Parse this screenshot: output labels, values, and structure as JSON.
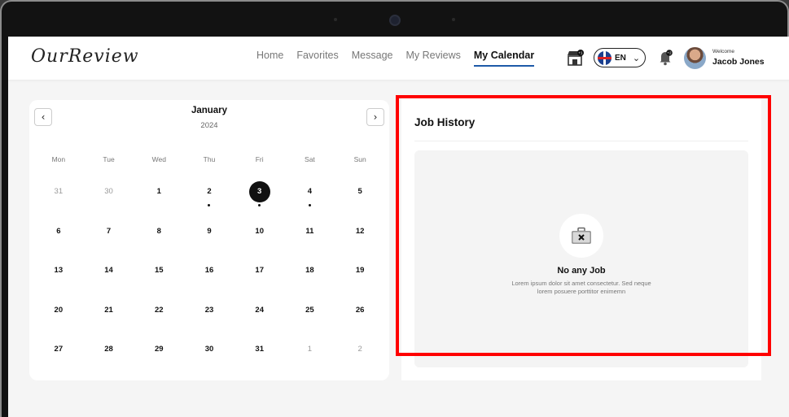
{
  "app": {
    "logo": "OurReview"
  },
  "nav": {
    "items": [
      {
        "label": "Home",
        "active": false
      },
      {
        "label": "Favorites",
        "active": false
      },
      {
        "label": "Message",
        "active": false
      },
      {
        "label": "My Reviews",
        "active": false
      },
      {
        "label": "My Calendar",
        "active": true
      }
    ]
  },
  "header": {
    "store_badge": "+1",
    "language": "EN",
    "notification_badge": "+2",
    "welcome": "Welcome",
    "user_name": "Jacob Jones"
  },
  "calendar": {
    "month": "January",
    "year": "2024",
    "weekdays": [
      "Mon",
      "Tue",
      "Wed",
      "Thu",
      "Fri",
      "Sat",
      "Sun"
    ],
    "days": [
      {
        "n": "31",
        "muted": true
      },
      {
        "n": "30",
        "muted": true
      },
      {
        "n": "1"
      },
      {
        "n": "2",
        "dot": true
      },
      {
        "n": "3",
        "selected": true,
        "dot": true
      },
      {
        "n": "4",
        "dot": true
      },
      {
        "n": "5"
      },
      {
        "n": "6"
      },
      {
        "n": "7"
      },
      {
        "n": "8"
      },
      {
        "n": "9"
      },
      {
        "n": "10"
      },
      {
        "n": "11"
      },
      {
        "n": "12"
      },
      {
        "n": "13"
      },
      {
        "n": "14"
      },
      {
        "n": "15"
      },
      {
        "n": "16"
      },
      {
        "n": "17"
      },
      {
        "n": "18"
      },
      {
        "n": "19"
      },
      {
        "n": "20"
      },
      {
        "n": "21"
      },
      {
        "n": "22"
      },
      {
        "n": "23"
      },
      {
        "n": "24"
      },
      {
        "n": "25"
      },
      {
        "n": "26"
      },
      {
        "n": "27"
      },
      {
        "n": "28"
      },
      {
        "n": "29"
      },
      {
        "n": "30"
      },
      {
        "n": "31"
      },
      {
        "n": "1",
        "muted": true
      },
      {
        "n": "2",
        "muted": true
      }
    ]
  },
  "job_history": {
    "title": "Job History",
    "empty_title": "No any Job",
    "empty_desc": "Lorem ipsum dolor sit amet consectetur. Sed neque lorem posuere porttitor enimemn"
  },
  "colors": {
    "accent": "#1e5aa8",
    "highlight": "#ff0000"
  }
}
